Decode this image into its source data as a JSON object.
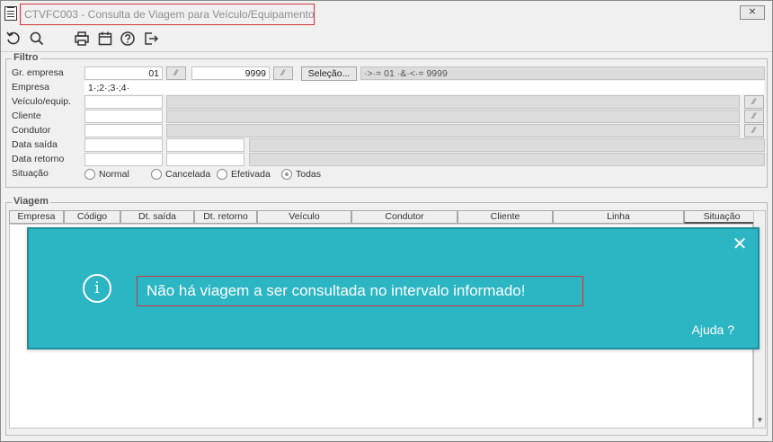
{
  "window": {
    "title": "CTVFC003 - Consulta de Viagem para Veículo/Equipamento",
    "close_label": "⨯"
  },
  "toolbar": {
    "icons": [
      "refresh-icon",
      "search-icon",
      "print-icon",
      "calendar-icon",
      "help-icon",
      "exit-icon"
    ]
  },
  "filtro": {
    "legend": "Filtro",
    "labels": {
      "gr_empresa": "Gr. empresa",
      "empresa": "Empresa",
      "veiculo": "Veículo/equip.",
      "cliente": "Cliente",
      "condutor": "Condutor",
      "data_saida": "Data saída",
      "data_retorno": "Data retorno",
      "situacao": "Situação"
    },
    "gr_empresa_from": "01",
    "gr_empresa_to": "9999",
    "selecao_label": "Seleção...",
    "selecao_expr": "·>·= 01 ·&·<·= 9999",
    "empresa_value": "1·;2·;3·;4·",
    "situacao_options": [
      "Normal",
      "Cancelada",
      "Efetivada",
      "Todas"
    ],
    "situacao_selected": "Todas"
  },
  "viagem": {
    "legend": "Viagem",
    "columns": [
      "Empresa",
      "Código",
      "Dt. saída",
      "Dt. retorno",
      "Veículo",
      "Condutor",
      "Cliente",
      "Linha",
      "Situação"
    ]
  },
  "toast": {
    "message": "Não há viagem a ser consultada no intervalo informado!",
    "help": "Ajuda ?",
    "close": "✕",
    "info_glyph": "i"
  },
  "colors": {
    "toast_bg": "#2cb5c3",
    "highlight": "#d0343c"
  }
}
